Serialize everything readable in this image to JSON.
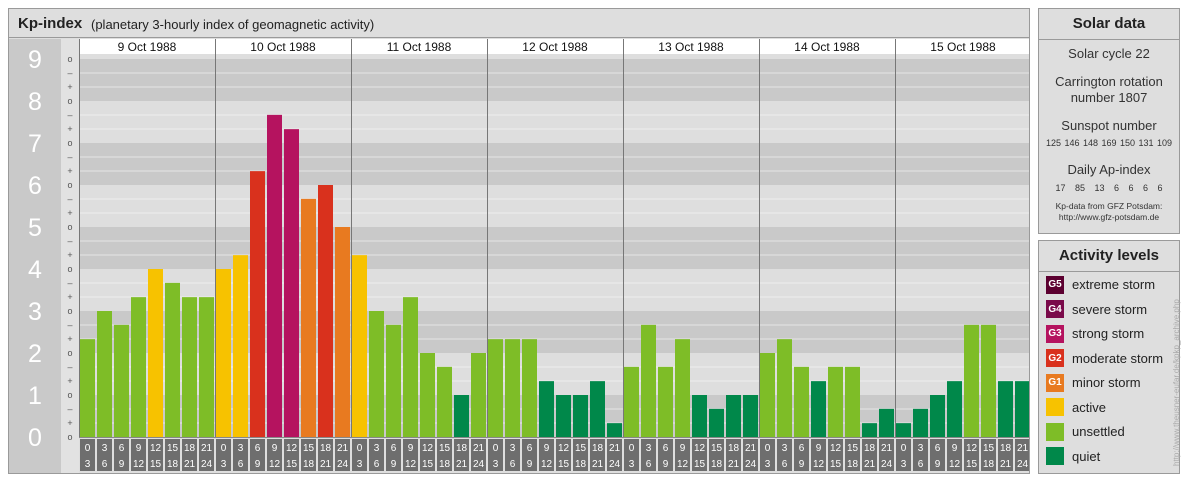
{
  "header": {
    "title": "Kp-index",
    "subtitle": "(planetary 3-hourly index of geomagnetic activity)"
  },
  "colors": {
    "extreme": "#5c0030",
    "severe": "#7a0a4a",
    "strong": "#b5135f",
    "moderate": "#d9311d",
    "minor": "#e87a20",
    "active": "#f7c200",
    "unsettled": "#7ebd27",
    "quiet": "#00884a"
  },
  "chart_data": {
    "type": "bar",
    "title": "Kp-index",
    "ylim": [
      0,
      9
    ],
    "y_ticks": [
      "0",
      "1",
      "2",
      "3",
      "4",
      "5",
      "6",
      "7",
      "8",
      "9"
    ],
    "sub_ticks": [
      "o",
      "+",
      "–"
    ],
    "days": [
      "9 Oct 1988",
      "10 Oct 1988",
      "11 Oct 1988",
      "12 Oct 1988",
      "13 Oct 1988",
      "14 Oct 1988",
      "15 Oct 1988"
    ],
    "intervals": [
      [
        "0",
        "3"
      ],
      [
        "3",
        "6"
      ],
      [
        "6",
        "9"
      ],
      [
        "9",
        "12"
      ],
      [
        "12",
        "15"
      ],
      [
        "15",
        "18"
      ],
      [
        "18",
        "21"
      ],
      [
        "21",
        "24"
      ]
    ],
    "values": [
      [
        2.33,
        3.0,
        2.67,
        3.33,
        4.0,
        3.67,
        3.33,
        3.33
      ],
      [
        4.0,
        4.33,
        6.33,
        7.67,
        7.33,
        5.67,
        6.0,
        5.0
      ],
      [
        4.33,
        3.0,
        2.67,
        3.33,
        2.0,
        1.67,
        1.0,
        2.0
      ],
      [
        2.33,
        2.33,
        2.33,
        1.33,
        1.0,
        1.0,
        1.33,
        0.33
      ],
      [
        1.67,
        2.67,
        1.67,
        2.33,
        1.0,
        0.67,
        1.0,
        1.0
      ],
      [
        2.0,
        2.33,
        1.67,
        1.33,
        1.67,
        1.67,
        0.33,
        0.67
      ],
      [
        0.33,
        0.67,
        1.0,
        1.33,
        2.67,
        2.67,
        1.33,
        1.33
      ]
    ]
  },
  "solar": {
    "title": "Solar data",
    "cycle": "Solar cycle 22",
    "carrington_1": "Carrington rotation",
    "carrington_2": "number 1807",
    "sunspot_title": "Sunspot number",
    "sunspot_values": "125 146 148 169 150 131 109",
    "ap_title": "Daily Ap-index",
    "ap_values": "17 85 13 6 6 6 6",
    "credit_1": "Kp-data from GFZ Potsdam:",
    "credit_2": "http://www.gfz-potsdam.de"
  },
  "activity": {
    "title": "Activity levels",
    "items": [
      {
        "badge": "G5",
        "label": "extreme storm",
        "color": "#5c0030"
      },
      {
        "badge": "G4",
        "label": "severe storm",
        "color": "#7a0a4a"
      },
      {
        "badge": "G3",
        "label": "strong storm",
        "color": "#b5135f"
      },
      {
        "badge": "G2",
        "label": "moderate storm",
        "color": "#d9311d"
      },
      {
        "badge": "G1",
        "label": "minor storm",
        "color": "#e87a20"
      },
      {
        "badge": "",
        "label": "active",
        "color": "#f7c200"
      },
      {
        "badge": "",
        "label": "unsettled",
        "color": "#7ebd27"
      },
      {
        "badge": "",
        "label": "quiet",
        "color": "#00884a"
      }
    ]
  },
  "watermark": "http://www.theusner-eufar.de/kpkp_archive.php"
}
